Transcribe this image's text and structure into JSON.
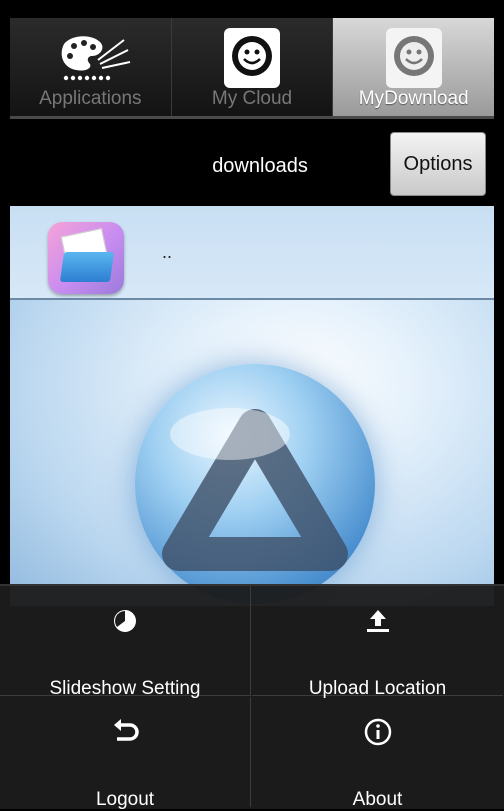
{
  "tabs": [
    {
      "label": "Applications",
      "icon": "palette-icon",
      "selected": false
    },
    {
      "label": "My Cloud",
      "icon": "smiley-network-icon",
      "selected": false
    },
    {
      "label": "MyDownload",
      "icon": "smiley-network-icon",
      "selected": true
    }
  ],
  "header": {
    "title": "downloads",
    "options_label": "Options"
  },
  "file_list": [
    {
      "name": ".."
    }
  ],
  "menu": {
    "items": [
      {
        "label": "Slideshow Setting",
        "icon": "clock-icon"
      },
      {
        "label": "Upload Location",
        "icon": "upload-icon"
      },
      {
        "label": "Logout",
        "icon": "back-arrow-icon"
      },
      {
        "label": "About",
        "icon": "info-icon"
      }
    ]
  },
  "colors": {
    "background": "#000000",
    "menu": "#1c1c1c",
    "selected_tab": "#c8c8c8"
  }
}
